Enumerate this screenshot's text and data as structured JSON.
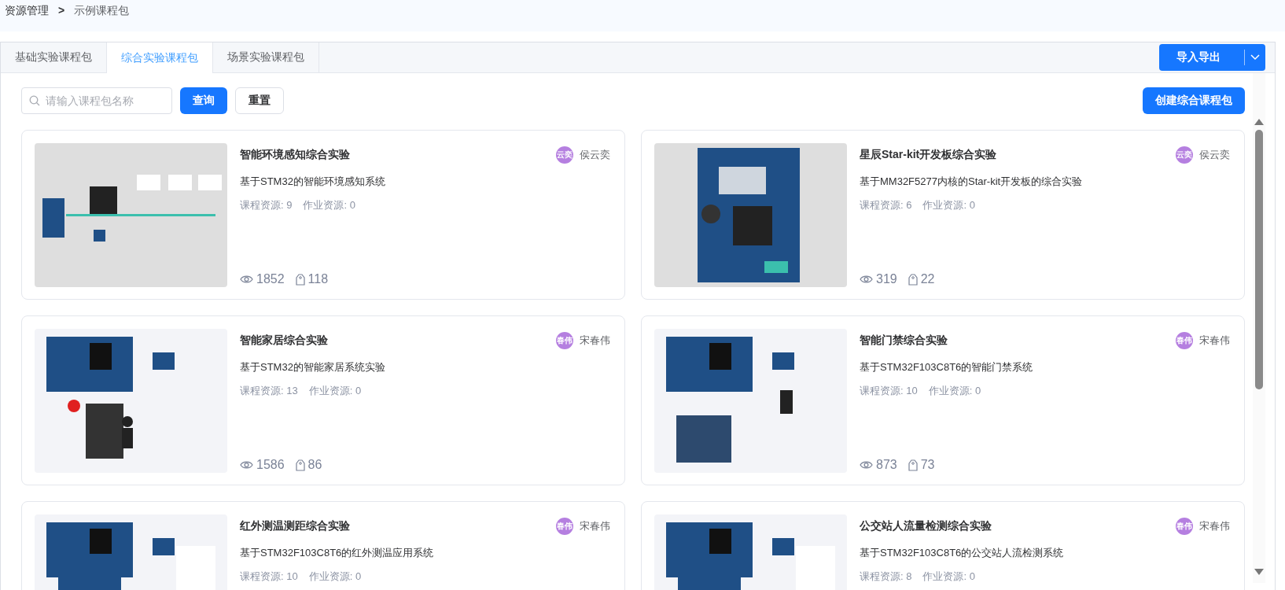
{
  "breadcrumb": [
    {
      "label": "资源管理"
    },
    {
      "label": ">"
    },
    {
      "label": "示例课程包"
    }
  ],
  "tabs": [
    {
      "label": "基础实验课程包",
      "selected": false
    },
    {
      "label": "综合实验课程包",
      "selected": true
    },
    {
      "label": "场景实验课程包",
      "selected": false
    }
  ],
  "import_export_button": {
    "label": "导入导出"
  },
  "search": {
    "placeholder": "请输入课程包名称"
  },
  "query_button": "查询",
  "reset_button": "重置",
  "create_button": "创建综合课程包",
  "cards": [
    {
      "title": "智能环境感知综合实验",
      "avatar": "云奕",
      "author": "侯云奕",
      "description": "基于STM32的智能环境感知系统",
      "course_resources": "课程资源: 9",
      "homework_resources": "作业资源: 0",
      "views": "1852",
      "favorites": "118"
    },
    {
      "title": "星辰Star-kit开发板综合实验",
      "avatar": "云奕",
      "author": "侯云奕",
      "description": "基于MM32F5277内核的Star-kit开发板的综合实验",
      "course_resources": "课程资源: 6",
      "homework_resources": "作业资源: 0",
      "views": "319",
      "favorites": "22"
    },
    {
      "title": "智能家居综合实验",
      "avatar": "春伟",
      "author": "宋春伟",
      "description": "基于STM32的智能家居系统实验",
      "course_resources": "课程资源: 13",
      "homework_resources": "作业资源: 0",
      "views": "1586",
      "favorites": "86"
    },
    {
      "title": "智能门禁综合实验",
      "avatar": "春伟",
      "author": "宋春伟",
      "description": "基于STM32F103C8T6的智能门禁系统",
      "course_resources": "课程资源: 10",
      "homework_resources": "作业资源: 0",
      "views": "873",
      "favorites": "73"
    },
    {
      "title": "红外测温测距综合实验",
      "avatar": "春伟",
      "author": "宋春伟",
      "description": "基于STM32F103C8T6的红外测温应用系统",
      "course_resources": "课程资源: 10",
      "homework_resources": "作业资源: 0"
    },
    {
      "title": "公交站人流量检测综合实验",
      "avatar": "春伟",
      "author": "宋春伟",
      "description": "基于STM32F103C8T6的公交站人流检测系统",
      "course_resources": "课程资源: 8",
      "homework_resources": "作业资源: 0"
    }
  ]
}
